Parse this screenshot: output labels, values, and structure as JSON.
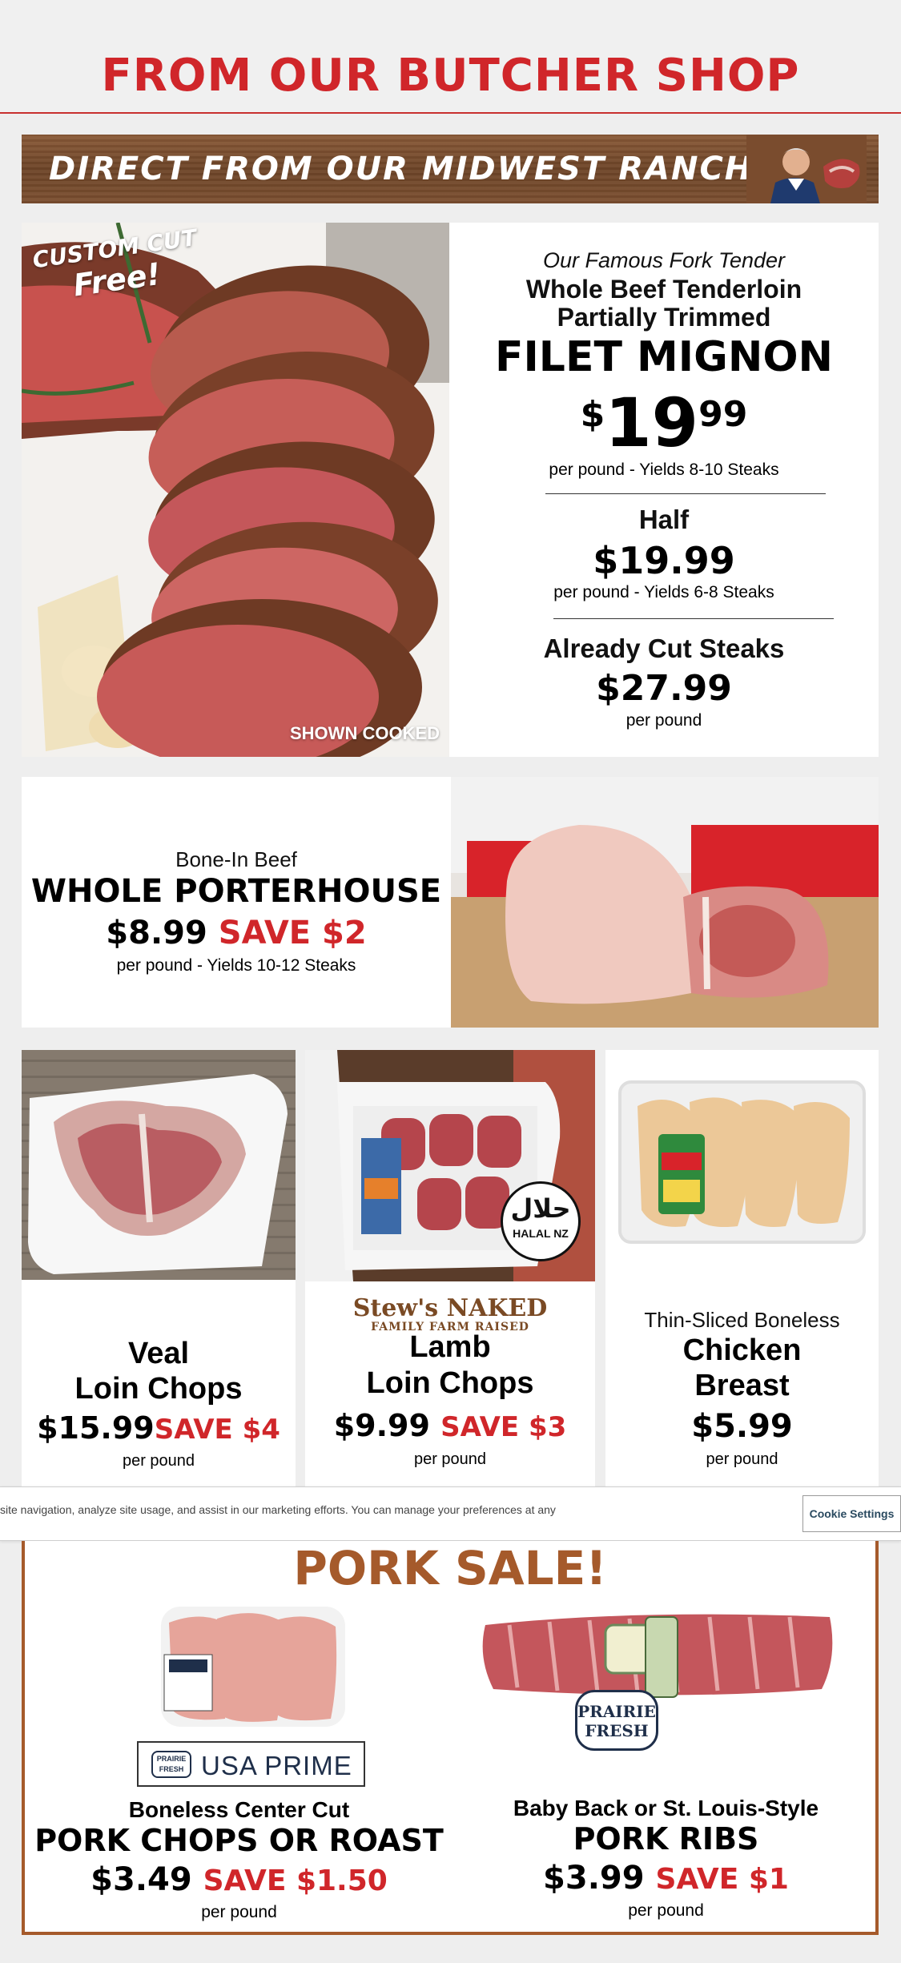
{
  "header": {
    "title": "FROM OUR BUTCHER SHOP"
  },
  "banner": {
    "text": "DIRECT FROM OUR MIDWEST RANCHERS!"
  },
  "filet": {
    "badge_line1": "CUSTOM CUT",
    "badge_line2": "Free!",
    "shown_cooked": "SHOWN COOKED",
    "intro": "Our Famous Fork Tender",
    "title_line1": "Whole Beef Tenderloin",
    "title_line2": "Partially Trimmed",
    "name": "FILET MIGNON",
    "price_dollar_sign": "$",
    "price_whole": "19",
    "price_cents": "99",
    "price_note": "per pound - Yields 8-10 Steaks",
    "half_label": "Half",
    "half_price": "$19.99",
    "half_note": "per pound - Yields 6-8 Steaks",
    "cut_label": "Already Cut Steaks",
    "cut_price": "$27.99",
    "cut_note": "per pound"
  },
  "porterhouse": {
    "subtitle": "Bone-In Beef",
    "name": "WHOLE PORTERHOUSE",
    "price": "$8.99",
    "save": "SAVE $2",
    "note": "per pound - Yields 10-12 Steaks"
  },
  "veal": {
    "line1": "Veal",
    "line2": "Loin Chops",
    "price": "$15.99",
    "save": "SAVE $4",
    "note": "per pound"
  },
  "lamb": {
    "brand_line1": "Stew's NAKED",
    "brand_line2": "FAMILY FARM RAISED",
    "halal_symbol": "حلال",
    "halal_label": "HALAL NZ",
    "line1": "Lamb",
    "line2": "Loin Chops",
    "price": "$9.99",
    "save": "SAVE $3",
    "note": "per pound"
  },
  "chicken": {
    "subtitle": "Thin-Sliced Boneless",
    "line1": "Chicken",
    "line2": "Breast",
    "price": "$5.99",
    "note": "per pound"
  },
  "cookie_bar": {
    "message": "site navigation, analyze site usage, and assist in our marketing efforts. You can manage your preferences at any",
    "button": "Cookie Settings"
  },
  "pork_sale": {
    "title": "PORK SALE!",
    "chops": {
      "logo_brand": "PRAIRIE FRESH",
      "logo_text": "USA PRIME",
      "subtitle": "Boneless Center Cut",
      "name": "PORK CHOPS OR ROAST",
      "price": "$3.49",
      "save": "SAVE $1.50",
      "note": "per pound"
    },
    "ribs": {
      "brand_badge": "PRAIRIE FRESH",
      "subtitle": "Baby Back or St. Louis-Style",
      "name": "PORK RIBS",
      "price": "$3.99",
      "save": "SAVE $1",
      "note": "per pound"
    }
  },
  "colors": {
    "accent_red": "#d0262a",
    "pork_brown": "#a55a2b",
    "banner_wood": "#6e4528"
  }
}
